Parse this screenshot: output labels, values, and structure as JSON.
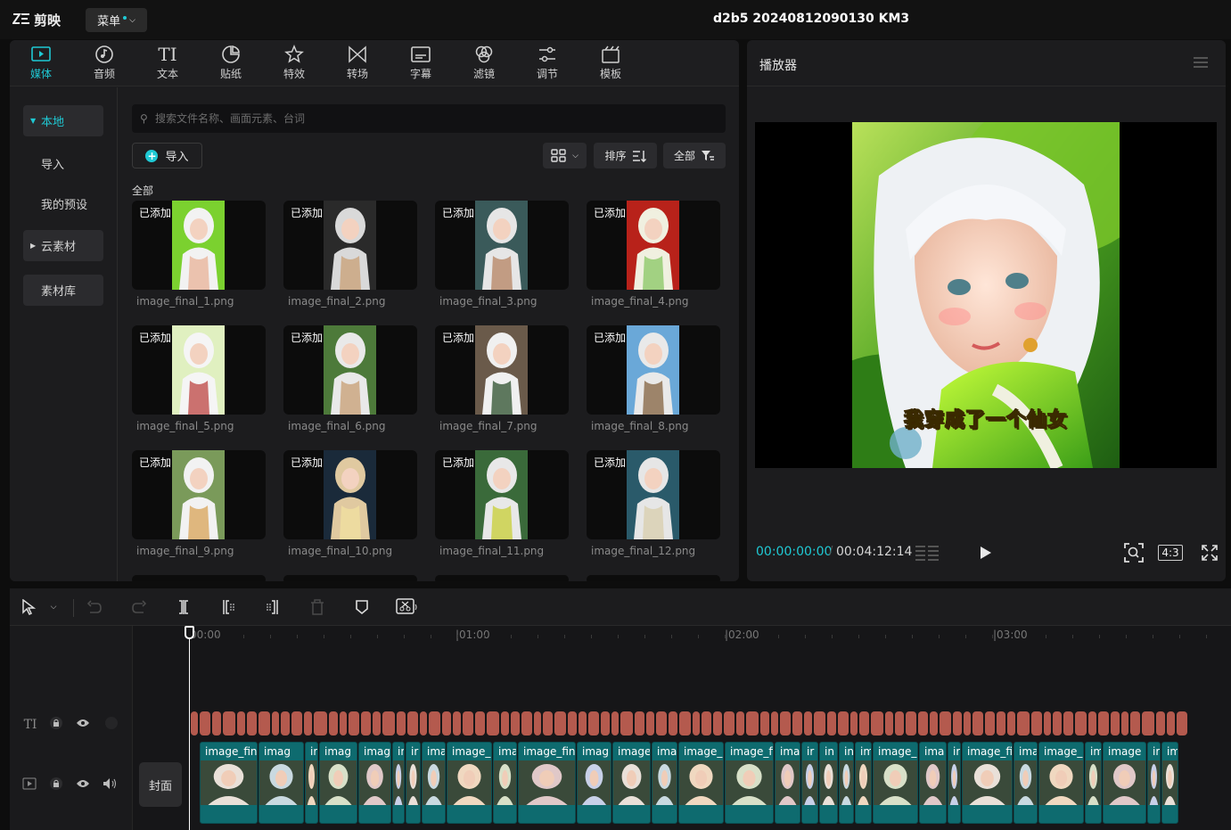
{
  "app": {
    "name": "剪映",
    "menu_label": "菜单",
    "project_title": "d2b5 20240812090130 KM3"
  },
  "tool_tabs": [
    {
      "label": "媒体",
      "icon": "media-icon",
      "active": true
    },
    {
      "label": "音频",
      "icon": "audio-icon"
    },
    {
      "label": "文本",
      "icon": "text-icon"
    },
    {
      "label": "贴纸",
      "icon": "sticker-icon"
    },
    {
      "label": "特效",
      "icon": "effects-icon"
    },
    {
      "label": "转场",
      "icon": "transition-icon"
    },
    {
      "label": "字幕",
      "icon": "subtitle-icon"
    },
    {
      "label": "滤镜",
      "icon": "filter-icon"
    },
    {
      "label": "调节",
      "icon": "adjust-icon"
    },
    {
      "label": "模板",
      "icon": "template-icon"
    }
  ],
  "side_nav": [
    {
      "label": "本地",
      "active": true,
      "expandable": true,
      "boxed": true
    },
    {
      "label": "导入"
    },
    {
      "label": "我的预设"
    },
    {
      "label": "云素材",
      "expandable": true,
      "boxed": true
    },
    {
      "label": "素材库",
      "boxed": true
    }
  ],
  "media": {
    "search_placeholder": "搜索文件名称、画面元素、台词",
    "import_label": "导入",
    "sort_label": "排序",
    "filter_label": "全部",
    "section_label": "全部",
    "added_badge": "已添加",
    "items": [
      {
        "name": "image_final_1.png"
      },
      {
        "name": "image_final_2.png"
      },
      {
        "name": "image_final_3.png"
      },
      {
        "name": "image_final_4.png"
      },
      {
        "name": "image_final_5.png"
      },
      {
        "name": "image_final_6.png"
      },
      {
        "name": "image_final_7.png"
      },
      {
        "name": "image_final_8.png"
      },
      {
        "name": "image_final_9.png"
      },
      {
        "name": "image_final_10.png"
      },
      {
        "name": "image_final_11.png"
      },
      {
        "name": "image_final_12.png"
      }
    ]
  },
  "player": {
    "title": "播放器",
    "subtitle": "我穿成了一个仙女",
    "time_current": "00:00:00:00",
    "time_total": "00:04:12:14",
    "ratio_label": "4:3"
  },
  "timeline": {
    "ruler_labels": [
      "00:00",
      "|01:00",
      "|02:00",
      "|03:00"
    ],
    "cover_label": "封面",
    "clips": [
      {
        "name": "image_fin"
      },
      {
        "name": "imag"
      },
      {
        "name": "ir"
      },
      {
        "name": "imag"
      },
      {
        "name": "imag"
      },
      {
        "name": "im"
      },
      {
        "name": "ir"
      },
      {
        "name": "ima"
      },
      {
        "name": "image_"
      },
      {
        "name": "ima"
      },
      {
        "name": "image_fina"
      },
      {
        "name": "imag"
      },
      {
        "name": "image"
      },
      {
        "name": "imag"
      },
      {
        "name": "image_"
      },
      {
        "name": "image_fi"
      },
      {
        "name": "imag"
      },
      {
        "name": "ir"
      },
      {
        "name": "in"
      },
      {
        "name": "in"
      },
      {
        "name": "im"
      },
      {
        "name": "image_"
      },
      {
        "name": "ima"
      },
      {
        "name": "ir"
      },
      {
        "name": "image_fi"
      },
      {
        "name": "ima"
      },
      {
        "name": "image_"
      },
      {
        "name": "im"
      },
      {
        "name": "image"
      },
      {
        "name": "ir"
      },
      {
        "name": "im"
      }
    ]
  },
  "colors": {
    "accent": "#1fc9d4",
    "clip": "#0e6b6f",
    "text_track": "#b45a4e"
  }
}
